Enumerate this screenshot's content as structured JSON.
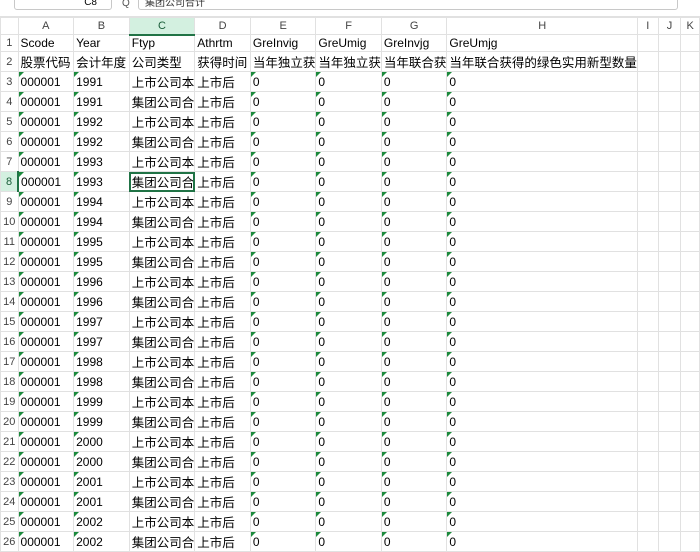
{
  "toolbar": {
    "name_box": "C8",
    "formula_icon": "fx-icon",
    "formula_value": "集团公司合计"
  },
  "columns": [
    "A",
    "B",
    "C",
    "D",
    "E",
    "F",
    "G",
    "H",
    "I",
    "J",
    "K"
  ],
  "active_column": "C",
  "active_row": 8,
  "rows": [
    {
      "n": "1",
      "cells": [
        "Scode",
        "Year",
        "Ftyp",
        "Athrtm",
        "GreInvig",
        "GreUmig",
        "GreInvjg",
        "GreUmjg",
        "",
        "",
        ""
      ]
    },
    {
      "n": "2",
      "cells": [
        "股票代码",
        "会计年度",
        "公司类型",
        "获得时间",
        "当年独立获",
        "当年独立获",
        "当年联合获",
        "当年联合获得的绿色实用新型数量",
        "",
        "",
        ""
      ]
    },
    {
      "n": "3",
      "cells": [
        "000001",
        "1991",
        "上市公司本",
        "上市后",
        "0",
        "0",
        "0",
        "0",
        "",
        "",
        ""
      ]
    },
    {
      "n": "4",
      "cells": [
        "000001",
        "1991",
        "集团公司合",
        "上市后",
        "0",
        "0",
        "0",
        "0",
        "",
        "",
        ""
      ]
    },
    {
      "n": "5",
      "cells": [
        "000001",
        "1992",
        "上市公司本",
        "上市后",
        "0",
        "0",
        "0",
        "0",
        "",
        "",
        ""
      ]
    },
    {
      "n": "6",
      "cells": [
        "000001",
        "1992",
        "集团公司合",
        "上市后",
        "0",
        "0",
        "0",
        "0",
        "",
        "",
        ""
      ]
    },
    {
      "n": "7",
      "cells": [
        "000001",
        "1993",
        "上市公司本",
        "上市后",
        "0",
        "0",
        "0",
        "0",
        "",
        "",
        ""
      ]
    },
    {
      "n": "8",
      "cells": [
        "000001",
        "1993",
        "集团公司合",
        "上市后",
        "0",
        "0",
        "0",
        "0",
        "",
        "",
        ""
      ]
    },
    {
      "n": "9",
      "cells": [
        "000001",
        "1994",
        "上市公司本",
        "上市后",
        "0",
        "0",
        "0",
        "0",
        "",
        "",
        ""
      ]
    },
    {
      "n": "10",
      "cells": [
        "000001",
        "1994",
        "集团公司合",
        "上市后",
        "0",
        "0",
        "0",
        "0",
        "",
        "",
        ""
      ]
    },
    {
      "n": "11",
      "cells": [
        "000001",
        "1995",
        "上市公司本",
        "上市后",
        "0",
        "0",
        "0",
        "0",
        "",
        "",
        ""
      ]
    },
    {
      "n": "12",
      "cells": [
        "000001",
        "1995",
        "集团公司合",
        "上市后",
        "0",
        "0",
        "0",
        "0",
        "",
        "",
        ""
      ]
    },
    {
      "n": "13",
      "cells": [
        "000001",
        "1996",
        "上市公司本",
        "上市后",
        "0",
        "0",
        "0",
        "0",
        "",
        "",
        ""
      ]
    },
    {
      "n": "14",
      "cells": [
        "000001",
        "1996",
        "集团公司合",
        "上市后",
        "0",
        "0",
        "0",
        "0",
        "",
        "",
        ""
      ]
    },
    {
      "n": "15",
      "cells": [
        "000001",
        "1997",
        "上市公司本",
        "上市后",
        "0",
        "0",
        "0",
        "0",
        "",
        "",
        ""
      ]
    },
    {
      "n": "16",
      "cells": [
        "000001",
        "1997",
        "集团公司合",
        "上市后",
        "0",
        "0",
        "0",
        "0",
        "",
        "",
        ""
      ]
    },
    {
      "n": "17",
      "cells": [
        "000001",
        "1998",
        "上市公司本",
        "上市后",
        "0",
        "0",
        "0",
        "0",
        "",
        "",
        ""
      ]
    },
    {
      "n": "18",
      "cells": [
        "000001",
        "1998",
        "集团公司合",
        "上市后",
        "0",
        "0",
        "0",
        "0",
        "",
        "",
        ""
      ]
    },
    {
      "n": "19",
      "cells": [
        "000001",
        "1999",
        "上市公司本",
        "上市后",
        "0",
        "0",
        "0",
        "0",
        "",
        "",
        ""
      ]
    },
    {
      "n": "20",
      "cells": [
        "000001",
        "1999",
        "集团公司合",
        "上市后",
        "0",
        "0",
        "0",
        "0",
        "",
        "",
        ""
      ]
    },
    {
      "n": "21",
      "cells": [
        "000001",
        "2000",
        "上市公司本",
        "上市后",
        "0",
        "0",
        "0",
        "0",
        "",
        "",
        ""
      ]
    },
    {
      "n": "22",
      "cells": [
        "000001",
        "2000",
        "集团公司合",
        "上市后",
        "0",
        "0",
        "0",
        "0",
        "",
        "",
        ""
      ]
    },
    {
      "n": "23",
      "cells": [
        "000001",
        "2001",
        "上市公司本",
        "上市后",
        "0",
        "0",
        "0",
        "0",
        "",
        "",
        ""
      ]
    },
    {
      "n": "24",
      "cells": [
        "000001",
        "2001",
        "集团公司合",
        "上市后",
        "0",
        "0",
        "0",
        "0",
        "",
        "",
        ""
      ]
    },
    {
      "n": "25",
      "cells": [
        "000001",
        "2002",
        "上市公司本",
        "上市后",
        "0",
        "0",
        "0",
        "0",
        "",
        "",
        ""
      ]
    },
    {
      "n": "26",
      "cells": [
        "000001",
        "2002",
        "集团公司合",
        "上市后",
        "0",
        "0",
        "0",
        "0",
        "",
        "",
        ""
      ]
    }
  ],
  "colors": {
    "accent": "#217346",
    "flag": "#1b8a3c",
    "active_header_bg": "#d3f0e0",
    "gridline": "#e1e1e1"
  }
}
